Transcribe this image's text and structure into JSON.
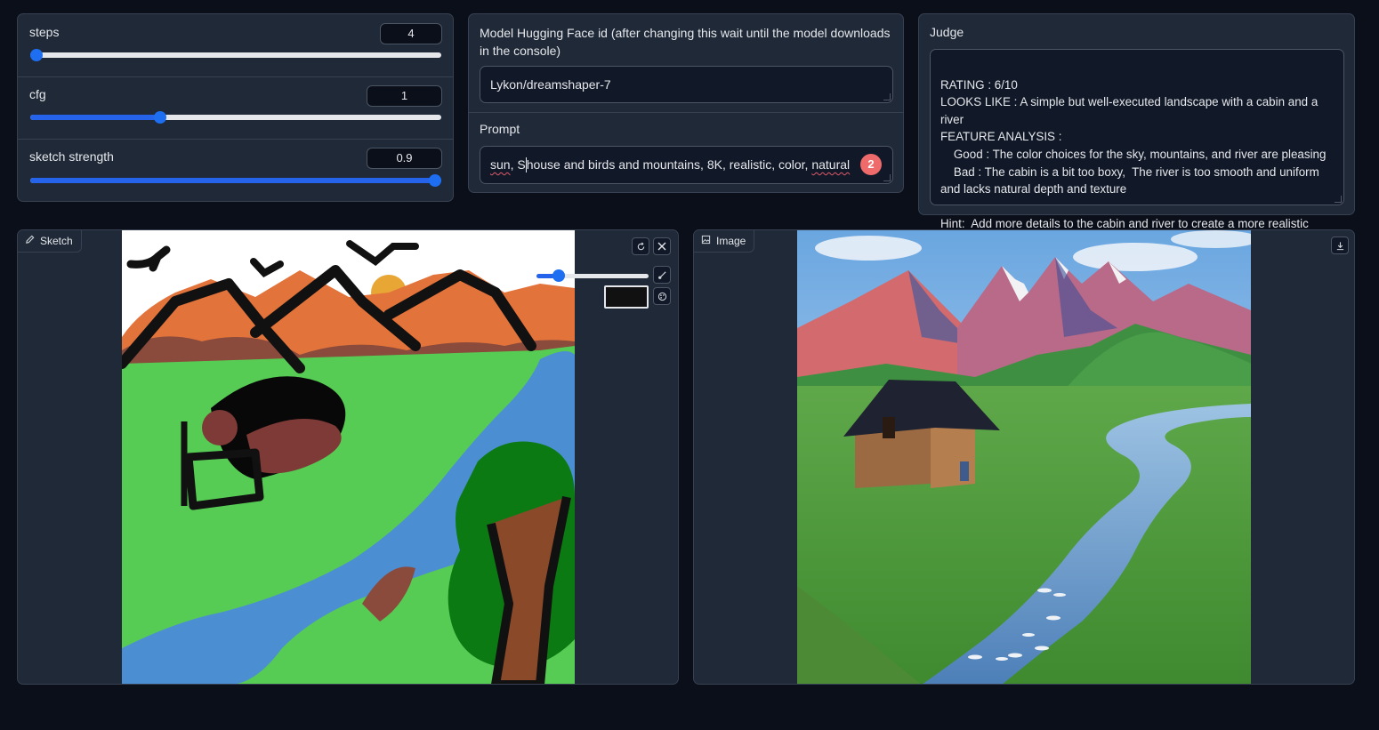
{
  "params": {
    "steps": {
      "label": "steps",
      "value": "4",
      "fraction": 0.0
    },
    "cfg": {
      "label": "cfg",
      "value": "1",
      "fraction": 0.315
    },
    "sketch_strength": {
      "label": "sketch strength",
      "value": "0.9",
      "fraction": 0.985
    }
  },
  "model": {
    "label": "Model Hugging Face id (after changing this wait until the model downloads in the console)",
    "value": "Lykon/dreamshaper-7"
  },
  "prompt": {
    "label": "Prompt",
    "word1": "sun",
    "sep1": ", ",
    "caret_before": "S",
    "middle": "house and birds and mountains, 8K, realistic, color, ",
    "word_last": "natural",
    "badge": "2"
  },
  "judge": {
    "label": "Judge",
    "lines": [
      "RATING : 6/10",
      "LOOKS LIKE : A simple but well-executed landscape with a cabin and a river",
      "FEATURE ANALYSIS :",
      "    Good : The color choices for the sky, mountains, and river are pleasing",
      "    Bad : The cabin is a bit too boxy,  The river is too smooth and uniform and lacks natural depth and texture",
      "",
      "Hint:  Add more details to the cabin and river to create a more realistic look"
    ]
  },
  "sketch": {
    "tab_label": "Sketch",
    "brush_size_fraction": 0.2
  },
  "image": {
    "tab_label": "Image"
  },
  "colors": {
    "accent": "#2563eb",
    "panel": "#1f2937",
    "bg": "#0b0f19",
    "badge": "#ef6b6b"
  }
}
